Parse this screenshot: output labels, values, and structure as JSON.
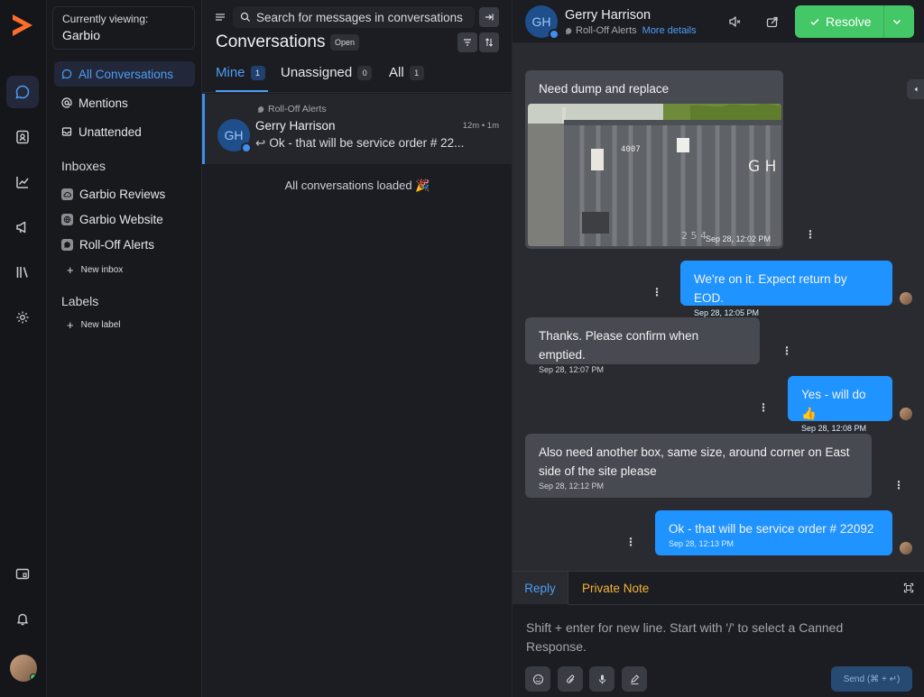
{
  "sidebar": {
    "viewing_label": "Currently viewing:",
    "account": "Garbio",
    "nav": [
      {
        "label": "All Conversations",
        "icon": "chat-bubble-icon"
      },
      {
        "label": "Mentions",
        "icon": "at-icon"
      },
      {
        "label": "Unattended",
        "icon": "inbox-tray-icon"
      }
    ],
    "inboxes_heading": "Inboxes",
    "inboxes": [
      {
        "label": "Garbio Reviews",
        "icon": "cloud-icon"
      },
      {
        "label": "Garbio Website",
        "icon": "globe-icon"
      },
      {
        "label": "Roll-Off Alerts",
        "icon": "chat-bubble-icon"
      }
    ],
    "new_inbox": "New inbox",
    "labels_heading": "Labels",
    "new_label": "New label"
  },
  "list": {
    "search_placeholder": "Search for messages in conversations",
    "title": "Conversations",
    "status_badge": "Open",
    "tabs": [
      {
        "label": "Mine",
        "count": "1"
      },
      {
        "label": "Unassigned",
        "count": "0"
      },
      {
        "label": "All",
        "count": "1"
      }
    ],
    "conversation": {
      "inbox": "Roll-Off Alerts",
      "initials": "GH",
      "name": "Gerry Harrison",
      "time": "12m • 1m",
      "preview": "Ok - that will be service order # 22..."
    },
    "loaded_text": "All conversations loaded 🎉"
  },
  "chat": {
    "contact_name": "Gerry Harrison",
    "initials": "GH",
    "inbox": "Roll-Off Alerts",
    "more_details": "More details",
    "resolve_label": "Resolve",
    "messages": [
      {
        "dir": "in",
        "text": "Need dump and replace",
        "time": "Sep 28, 12:02 PM",
        "has_image": true
      },
      {
        "dir": "out",
        "text": "We're on it. Expect return by EOD.",
        "time": "Sep 28, 12:05 PM"
      },
      {
        "dir": "in",
        "text": "Thanks. Please confirm when emptied.",
        "time": "Sep 28, 12:07 PM"
      },
      {
        "dir": "out",
        "text": "Yes - will do 👍",
        "time": "Sep 28, 12:08 PM"
      },
      {
        "dir": "in",
        "text": "Also need another box, same size, around corner on East side of the site please",
        "time": "Sep 28, 12:12 PM"
      },
      {
        "dir": "out",
        "text": "Ok - that will be service order # 22092",
        "time": "Sep 28, 12:13 PM"
      }
    ],
    "image_text": {
      "number": "4007",
      "letters": "G H",
      "digits": "2 5 4"
    },
    "reply_tab": "Reply",
    "note_tab": "Private Note",
    "reply_placeholder": "Shift + enter for new line. Start with '/' to select a Canned Response.",
    "send_label": "Send (⌘ + ↵)"
  },
  "colors": {
    "accent": "#1f93ff",
    "resolve": "#44c767",
    "private_note": "#f3b23a",
    "logo": "#ff6d2d"
  }
}
